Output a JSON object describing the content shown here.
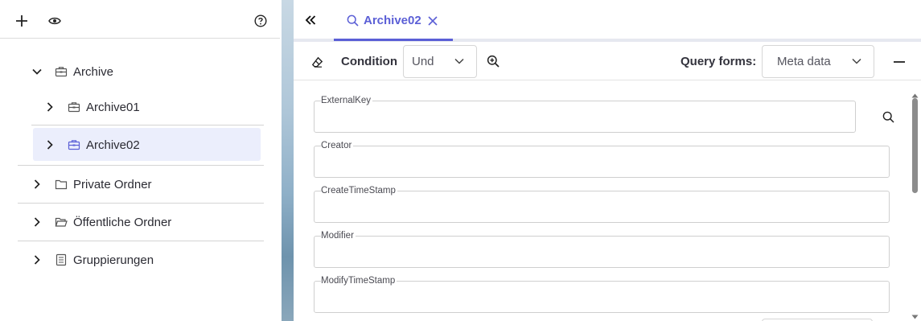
{
  "left_panel": {
    "toolbar": {
      "add_icon": "plus-icon",
      "view_icon": "eye-icon",
      "help_icon": "question-circle-icon"
    },
    "tree": [
      {
        "label": "Archive",
        "icon": "archive-box-icon",
        "expanded": true
      },
      {
        "label": "Archive01",
        "icon": "archive-box-icon",
        "expanded": false
      },
      {
        "label": "Archive02",
        "icon": "archive-box-icon",
        "expanded": false,
        "selected": true
      },
      {
        "label": "Private Ordner",
        "icon": "folder-icon",
        "expanded": false
      },
      {
        "label": "Öffentliche Ordner",
        "icon": "folder-open-icon",
        "expanded": false
      },
      {
        "label": "Gruppierungen",
        "icon": "document-list-icon",
        "expanded": false
      }
    ]
  },
  "right_panel": {
    "collapse_icon": "double-chevron-left-icon",
    "tab": {
      "label": "Archive02",
      "icon": "search-icon",
      "close_icon": "close-icon"
    },
    "toolbar": {
      "eraser_icon": "eraser-icon",
      "condition_label": "Condition",
      "condition_value": "Und",
      "zoom_icon": "zoom-in-icon",
      "query_forms_label": "Query forms:",
      "query_forms_value": "Meta data",
      "minimize_icon": "minus-icon"
    },
    "fields": [
      {
        "label": "ExternalKey",
        "value": ""
      },
      {
        "label": "Creator",
        "value": ""
      },
      {
        "label": "CreateTimeStamp",
        "value": ""
      },
      {
        "label": "Modifier",
        "value": ""
      },
      {
        "label": "ModifyTimeStamp",
        "value": ""
      }
    ]
  },
  "colors": {
    "accent": "#5b5fd6",
    "selected_row_bg": "#ebeefc",
    "text": "#2b2b33"
  }
}
